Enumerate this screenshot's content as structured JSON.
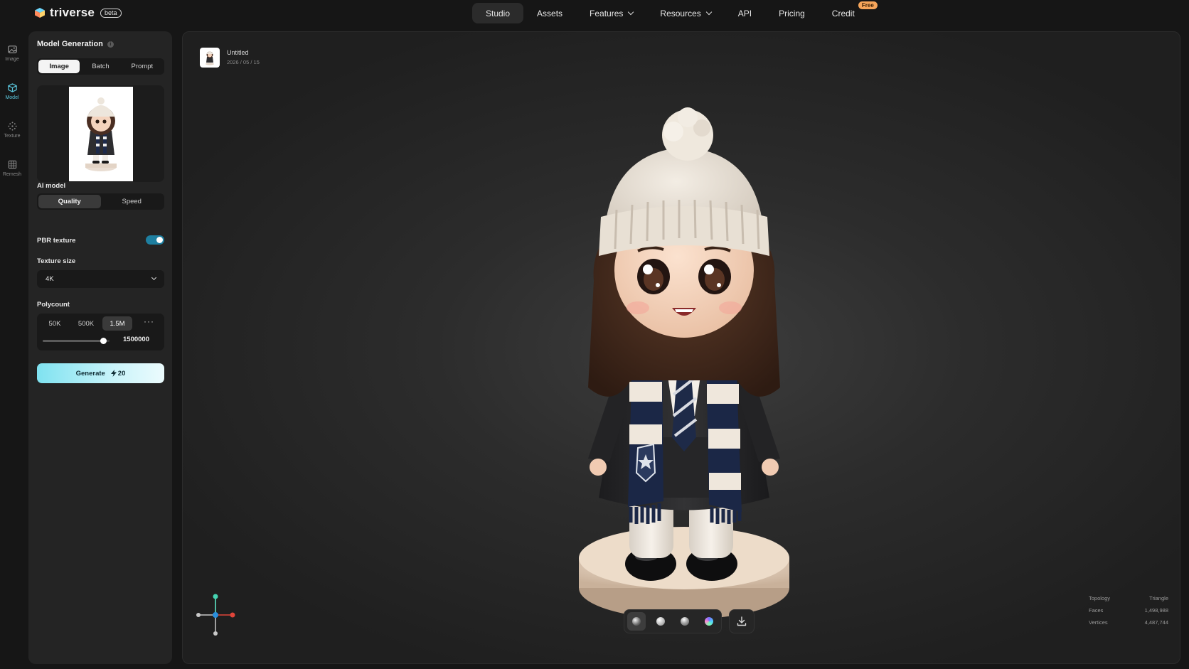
{
  "brand": {
    "name": "triverse",
    "badge": "beta"
  },
  "nav": {
    "items": [
      {
        "label": "Studio",
        "active": true
      },
      {
        "label": "Assets"
      },
      {
        "label": "Features",
        "dropdown": true
      },
      {
        "label": "Resources",
        "dropdown": true
      },
      {
        "label": "API"
      },
      {
        "label": "Pricing"
      },
      {
        "label": "Credit",
        "badge": "Free"
      }
    ]
  },
  "rail": [
    {
      "label": "Image",
      "icon": "image-icon"
    },
    {
      "label": "Model",
      "icon": "cube-icon",
      "active": true
    },
    {
      "label": "Texture",
      "icon": "texture-icon"
    },
    {
      "label": "Remesh",
      "icon": "grid-icon"
    }
  ],
  "panel": {
    "title": "Model Generation",
    "info_icon": "i",
    "input_tabs": [
      "Image",
      "Batch",
      "Prompt"
    ],
    "input_tab_active": "Image",
    "ai_model_label": "AI model",
    "ai_model_options": [
      "Quality",
      "Speed"
    ],
    "ai_model_active": "Quality",
    "pbr_label": "PBR texture",
    "pbr_enabled": true,
    "texture_size_label": "Texture size",
    "texture_size_value": "4K",
    "polycount_label": "Polycount",
    "polycount_options": [
      "50K",
      "500K",
      "1.5M"
    ],
    "polycount_active": "1.5M",
    "polycount_more": "···",
    "polycount_value": "1500000",
    "polycount_fraction": 0.9,
    "generate_label": "Generate",
    "generate_cost": "20",
    "generate_cost_icon": "bolt-icon"
  },
  "viewport": {
    "file_name": "Untitled",
    "file_date": "2026 / 05 / 15",
    "stats": [
      {
        "label": "Topology",
        "value": "Triangle"
      },
      {
        "label": "Faces",
        "value": "1,498,988"
      },
      {
        "label": "Vertices",
        "value": "4,487,744"
      }
    ],
    "render_modes": [
      "shaded-icon",
      "clay-icon",
      "matcap-icon",
      "normal-icon"
    ],
    "download_icon": "download-icon"
  },
  "colors": {
    "accent": "#5bc8df",
    "toggle": "#1e7fa0",
    "generate_from": "#7fe2f0",
    "generate_to": "#ecfbfd",
    "free_badge": "#f6a55a"
  }
}
